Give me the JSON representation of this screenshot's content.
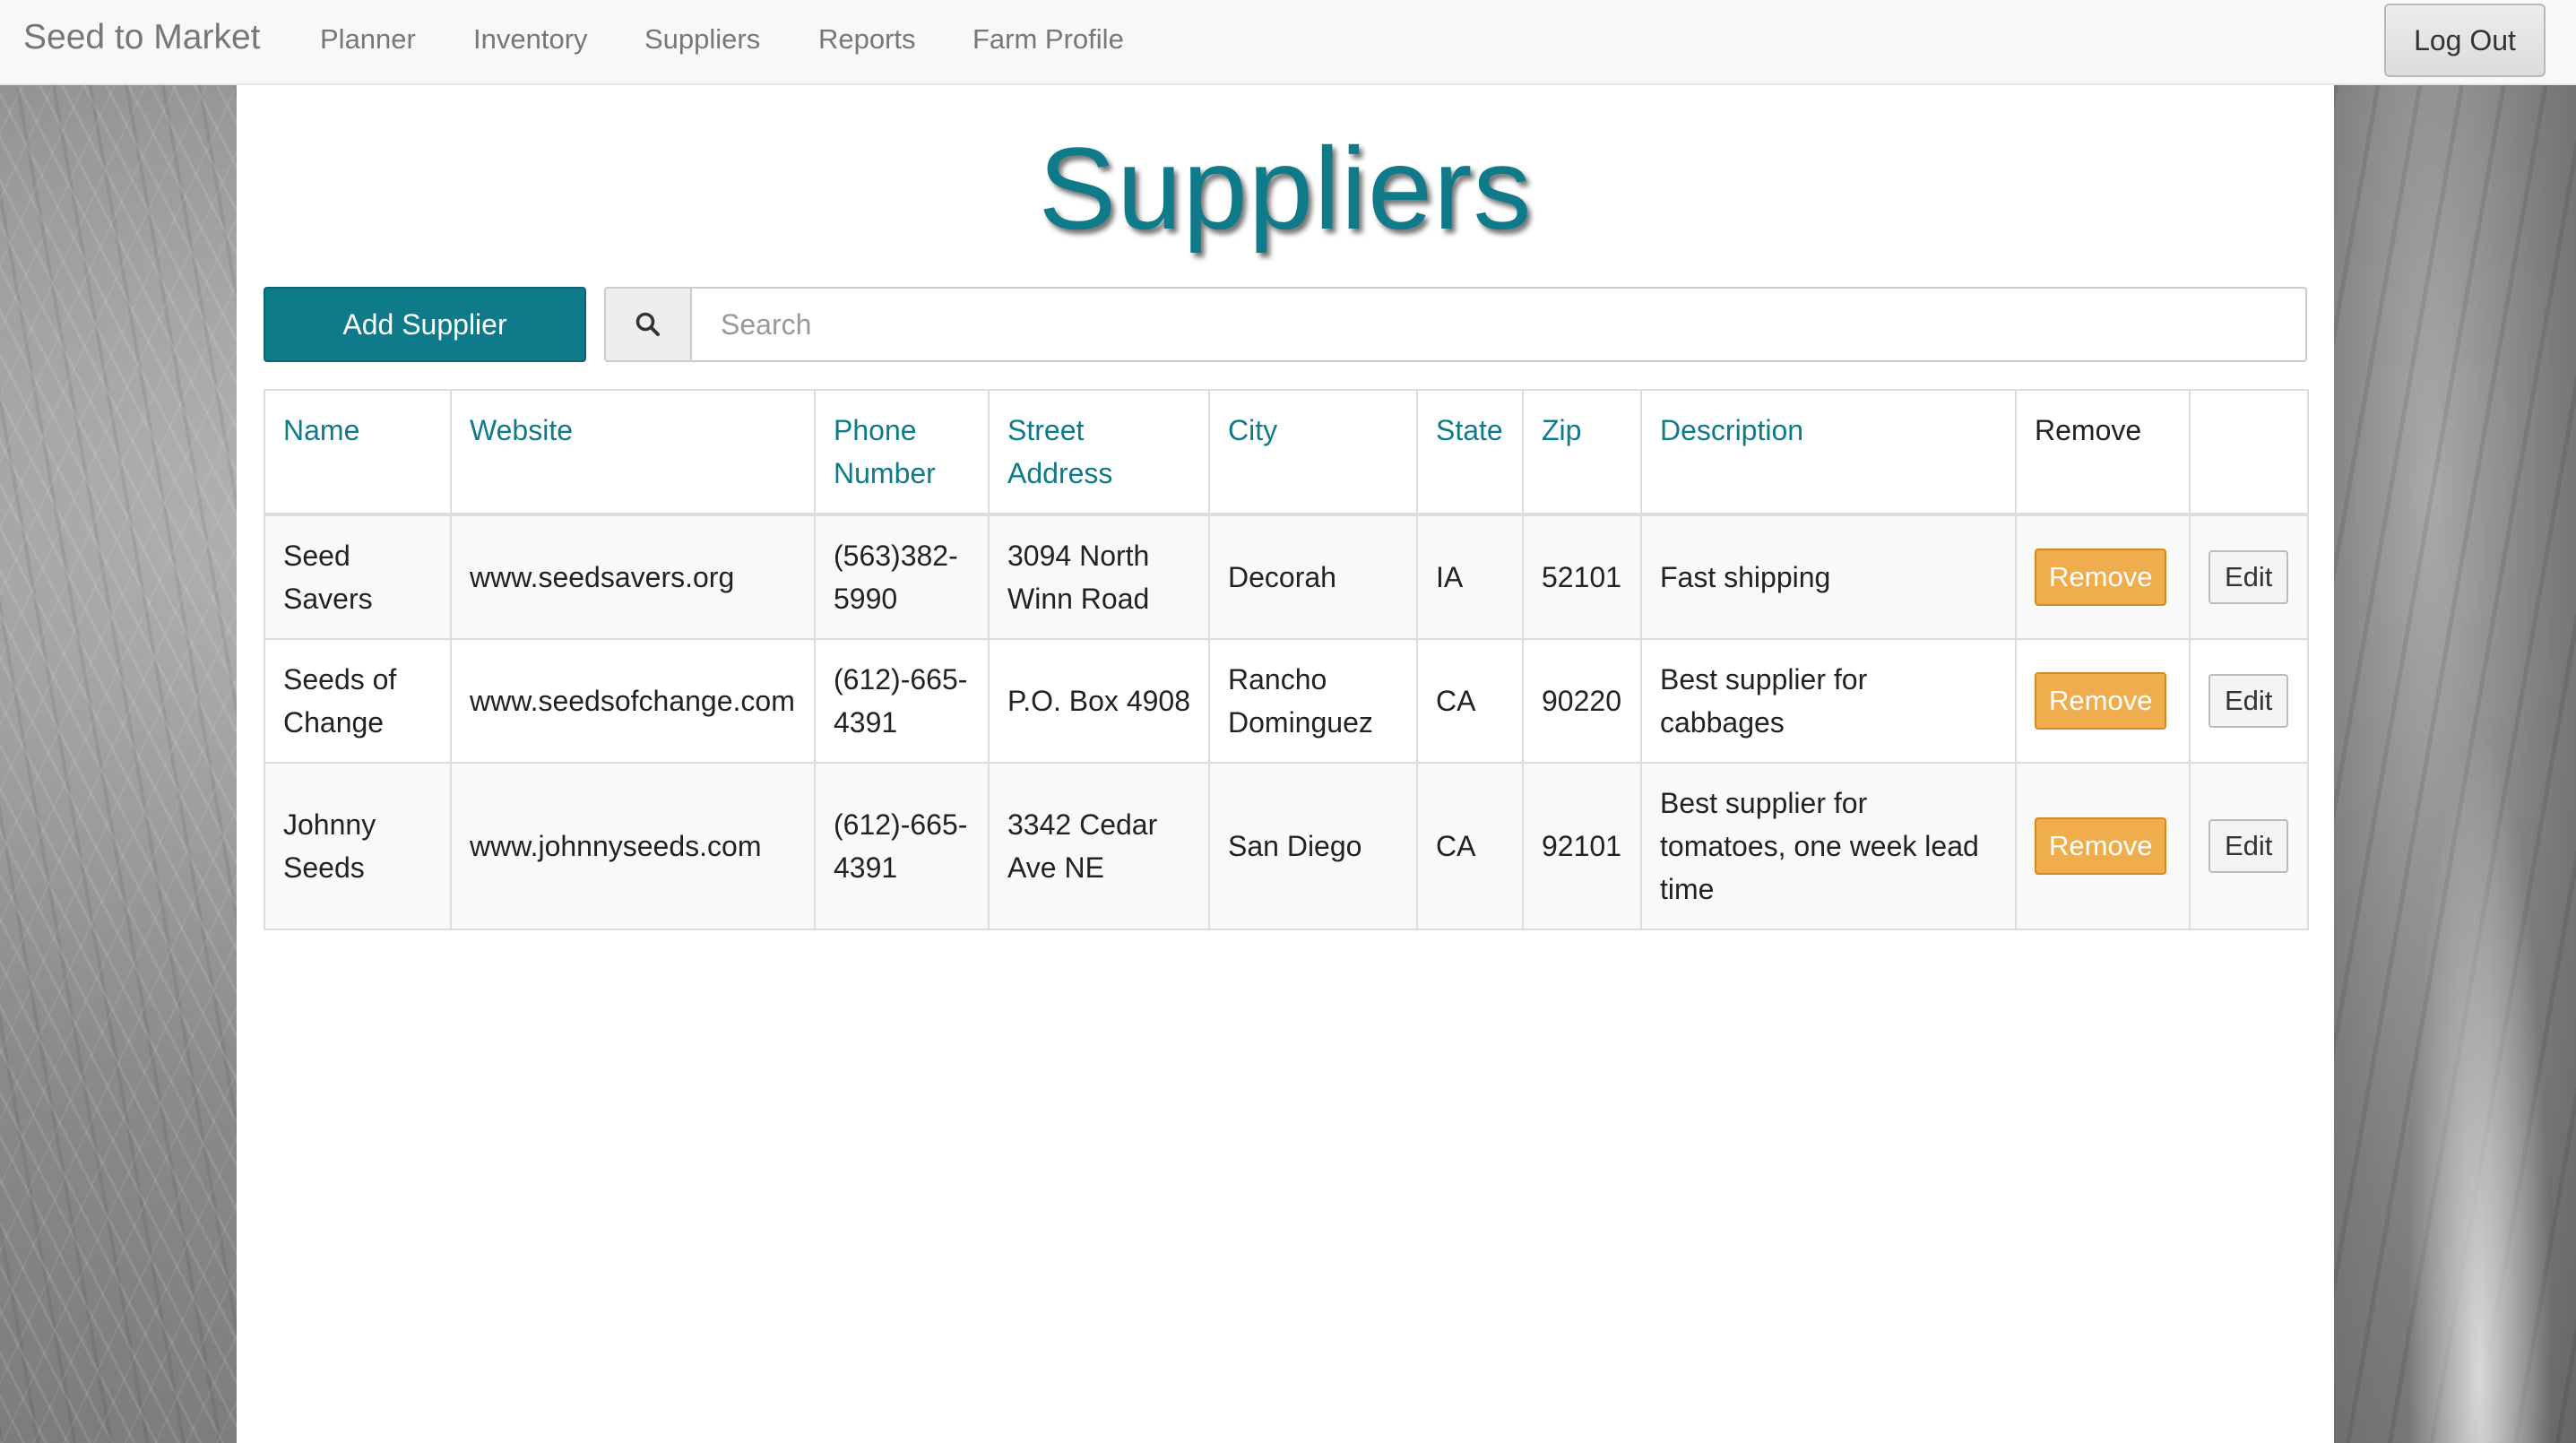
{
  "nav": {
    "brand": "Seed to Market",
    "links": [
      "Planner",
      "Inventory",
      "Suppliers",
      "Reports",
      "Farm Profile"
    ],
    "logout_label": "Log Out"
  },
  "page": {
    "title": "Suppliers",
    "add_button": "Add Supplier",
    "search": {
      "placeholder": "Search",
      "value": ""
    }
  },
  "table": {
    "headers": [
      "Name",
      "Website",
      "Phone Number",
      "Street Address",
      "City",
      "State",
      "Zip",
      "Description",
      "Remove",
      ""
    ],
    "remove_label": "Remove",
    "edit_label": "Edit",
    "rows": [
      {
        "name": "Seed Savers",
        "website": "www.seedsavers.org",
        "phone": "(563)382-5990",
        "street": "3094 North Winn Road",
        "city": "Decorah",
        "state": "IA",
        "zip": "52101",
        "description": "Fast shipping"
      },
      {
        "name": "Seeds of Change",
        "website": "www.seedsofchange.com",
        "phone": "(612)-665-4391",
        "street": "P.O. Box 4908",
        "city": "Rancho Dominguez",
        "state": "CA",
        "zip": "90220",
        "description": "Best supplier for cabbages"
      },
      {
        "name": "Johnny Seeds",
        "website": "www.johnnyseeds.com",
        "phone": "(612)-665-4391",
        "street": "3342 Cedar Ave NE",
        "city": "San Diego",
        "state": "CA",
        "zip": "92101",
        "description": "Best supplier for tomatoes, one week lead time"
      }
    ]
  },
  "colors": {
    "accent": "#0e7a8a",
    "remove": "#f0ad4e",
    "navbar": "#f8f8f8"
  }
}
